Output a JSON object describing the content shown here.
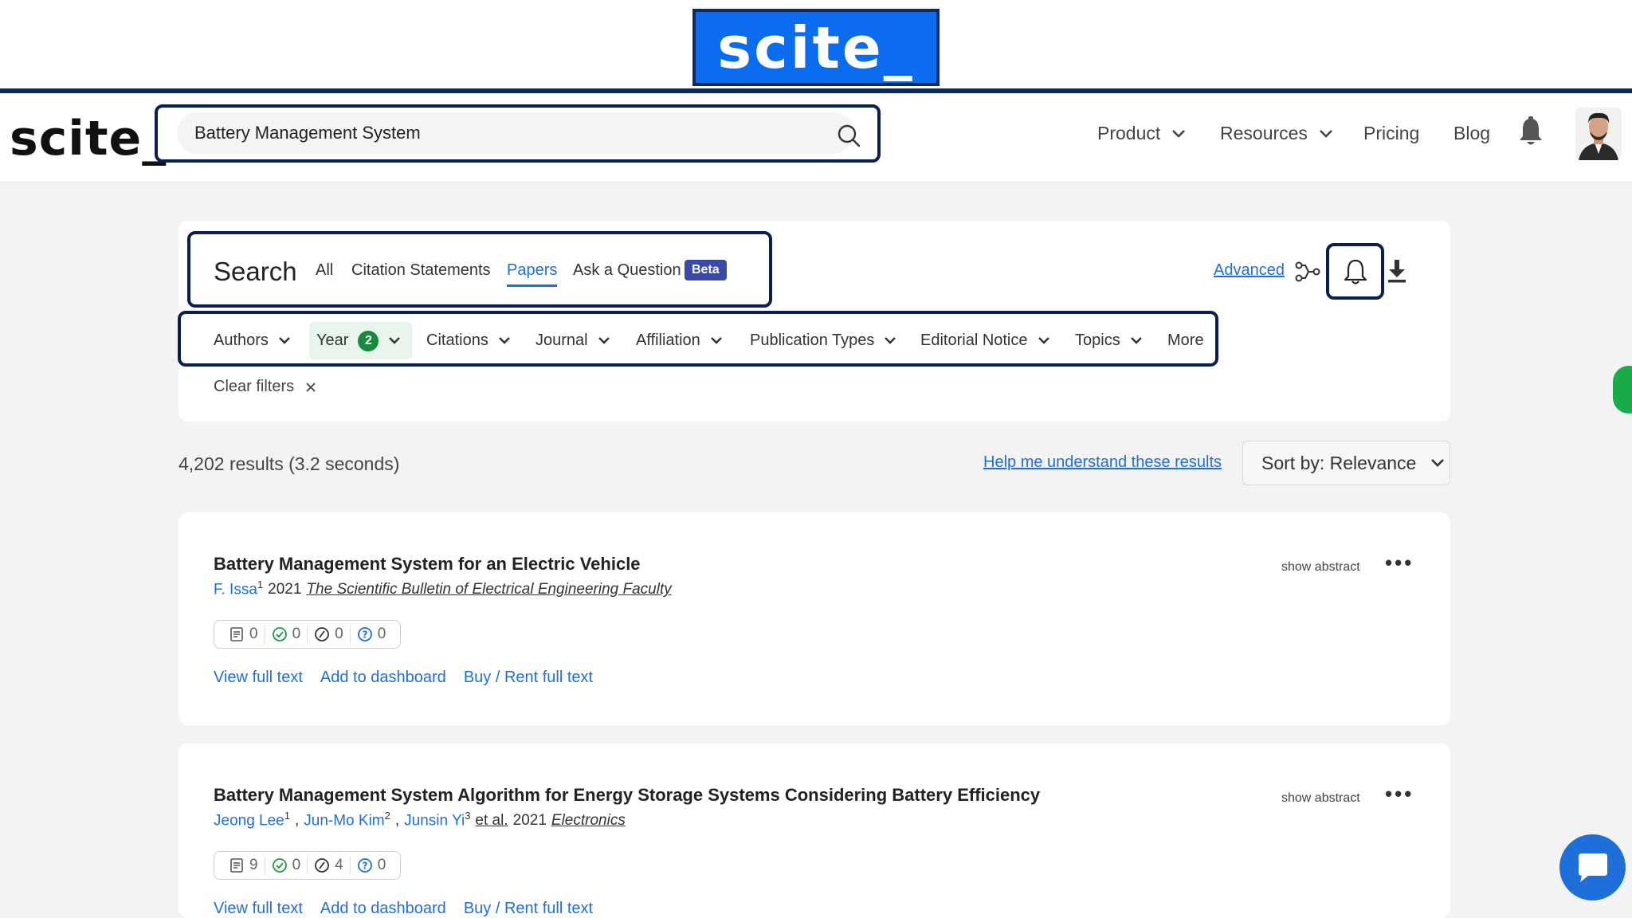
{
  "banner": {
    "logo_text": "scite_"
  },
  "header": {
    "logo_text": "scite_",
    "search_value": "Battery Management System",
    "nav": {
      "product": "Product",
      "resources": "Resources",
      "pricing": "Pricing",
      "blog": "Blog"
    }
  },
  "search_panel": {
    "title": "Search",
    "tabs": {
      "all": "All",
      "citation_statements": "Citation Statements",
      "papers": "Papers",
      "ask": "Ask a Question"
    },
    "active_tab": "Papers",
    "beta_badge": "Beta",
    "advanced": "Advanced",
    "filters": {
      "authors": "Authors",
      "year": "Year",
      "year_count": "2",
      "citations": "Citations",
      "journal": "Journal",
      "affiliation": "Affiliation",
      "publication_types": "Publication Types",
      "editorial_notice": "Editorial Notice",
      "topics": "Topics",
      "more": "More"
    },
    "clear_filters": "Clear filters"
  },
  "results": {
    "count_text": "4,202 results (3.2 seconds)",
    "help_link": "Help me understand these results",
    "sort_label": "Sort by: Relevance",
    "show_abstract": "show abstract",
    "actions": {
      "view": "View full text",
      "dashboard": "Add to dashboard",
      "buy": "Buy / Rent full text"
    },
    "items": [
      {
        "title": "Battery Management System for an Electric Vehicle",
        "author1": "F. Issa",
        "author1_sup": "1",
        "year": "2021",
        "journal": "The Scientific Bulletin of Electrical Engineering Faculty",
        "stats": [
          "0",
          "0",
          "0",
          "0"
        ]
      },
      {
        "title": "Battery Management System Algorithm for Energy Storage Systems Considering Battery Efficiency",
        "author1": "Jeong Lee",
        "author1_sup": "1",
        "author2": "Jun-Mo Kim",
        "author2_sup": "2",
        "author3": "Junsin Yi",
        "author3_sup": "3",
        "etal": "et al.",
        "year": "2021",
        "journal": "Electronics",
        "stats": [
          "9",
          "0",
          "4",
          "0"
        ]
      }
    ]
  },
  "colors": {
    "accent_blue": "#1e6fd9",
    "frame_navy": "#0a1f4f",
    "brand_blue": "#0b6cf0",
    "year_green": "#178a3e"
  }
}
